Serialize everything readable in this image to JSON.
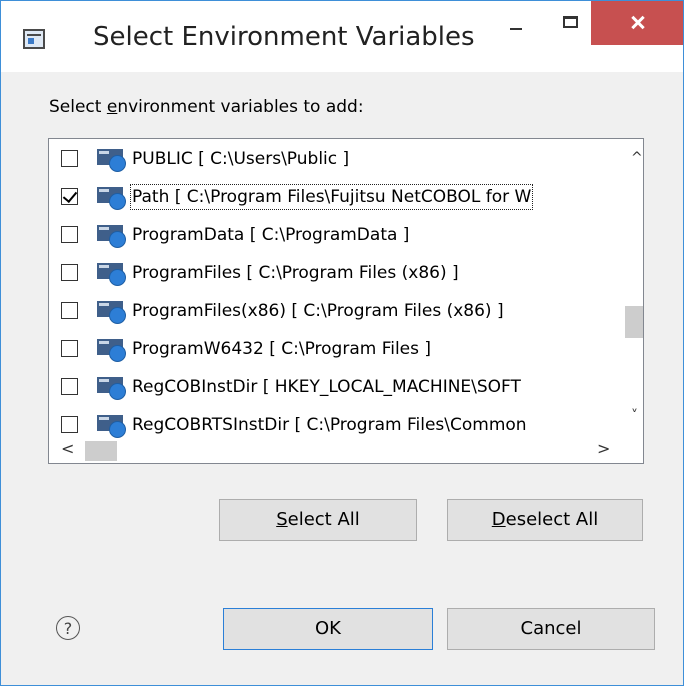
{
  "window": {
    "title": "Select Environment Variables",
    "controls": {
      "minimize": "minimize",
      "maximize": "maximize",
      "close": "close"
    }
  },
  "prompt": {
    "before": "Select ",
    "accel": "e",
    "after": "nvironment variables to add:"
  },
  "variables": [
    {
      "text": "PUBLIC [ C:\\Users\\Public ]",
      "checked": false,
      "selected": false
    },
    {
      "text": "Path [ C:\\Program Files\\Fujitsu NetCOBOL for W",
      "checked": true,
      "selected": true
    },
    {
      "text": "ProgramData [ C:\\ProgramData ]",
      "checked": false,
      "selected": false
    },
    {
      "text": "ProgramFiles [ C:\\Program Files (x86) ]",
      "checked": false,
      "selected": false
    },
    {
      "text": "ProgramFiles(x86) [ C:\\Program Files (x86) ]",
      "checked": false,
      "selected": false
    },
    {
      "text": "ProgramW6432 [ C:\\Program Files ]",
      "checked": false,
      "selected": false
    },
    {
      "text": "RegCOBInstDir [ HKEY_LOCAL_MACHINE\\SOFT",
      "checked": false,
      "selected": false
    },
    {
      "text": "RegCOBRTSInstDir [ C:\\Program Files\\Common",
      "checked": false,
      "selected": false
    }
  ],
  "buttons": {
    "select_all": {
      "accel": "S",
      "rest": "elect All"
    },
    "deselect_all": {
      "accel": "D",
      "rest": "eselect All"
    },
    "ok": "OK",
    "cancel": "Cancel"
  },
  "icons": {
    "help": "?",
    "scroll_up": "^",
    "scroll_down": "˅",
    "scroll_left": "<",
    "scroll_right": ">"
  }
}
